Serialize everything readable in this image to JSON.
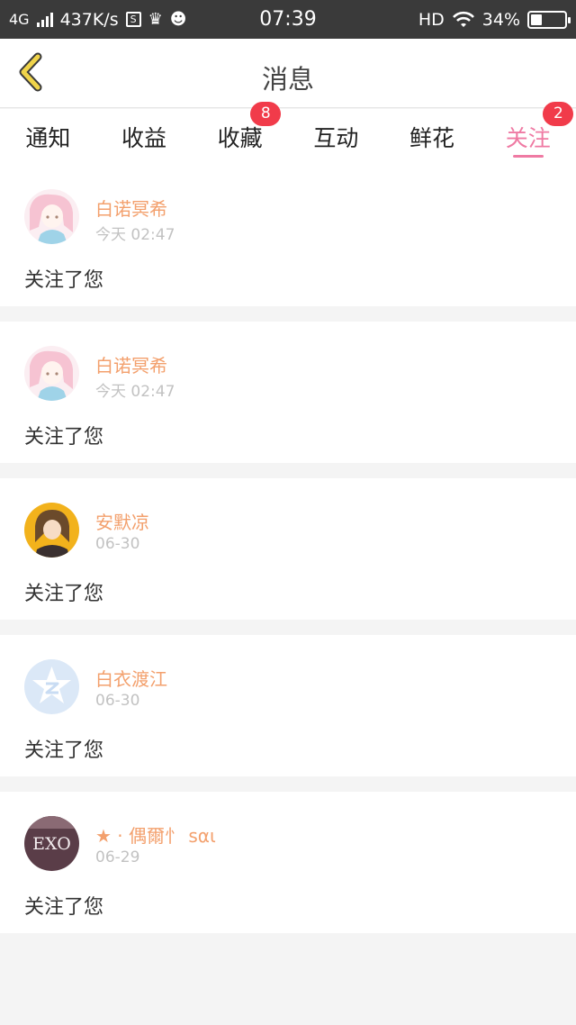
{
  "status_bar": {
    "network": "4G",
    "speed": "437K/s",
    "time": "07:39",
    "hd": "HD",
    "battery": "34%",
    "battery_level": 0.34
  },
  "header": {
    "title": "消息",
    "back_icon": "chevron-left-icon"
  },
  "tabs": [
    {
      "label": "通知",
      "badge": null,
      "active": false
    },
    {
      "label": "收益",
      "badge": null,
      "active": false
    },
    {
      "label": "收藏",
      "badge": "8",
      "active": false
    },
    {
      "label": "互动",
      "badge": null,
      "active": false
    },
    {
      "label": "鲜花",
      "badge": null,
      "active": false
    },
    {
      "label": "关注",
      "badge": "2",
      "active": true
    }
  ],
  "messages": [
    {
      "name": "白诺冥希",
      "time": "今天 02:47",
      "text": "关注了您",
      "avatar": "anime-girl-pink"
    },
    {
      "name": "白诺冥希",
      "time": "今天 02:47",
      "text": "关注了您",
      "avatar": "anime-girl-pink"
    },
    {
      "name": "安默凉",
      "time": "06-30",
      "text": "关注了您",
      "avatar": "anime-girl-yellow"
    },
    {
      "name": "白衣渡江",
      "time": "06-30",
      "text": "关注了您",
      "avatar": "default-star-z"
    },
    {
      "name": "★ · 偶爾忄 sαι",
      "time": "06-29",
      "text": "关注了您",
      "avatar": "exo-logo"
    }
  ],
  "colors": {
    "accent": "#ef7aa3",
    "username": "#f3a06d",
    "badge": "#f13b4a",
    "back_icon": "#f0d44a"
  }
}
